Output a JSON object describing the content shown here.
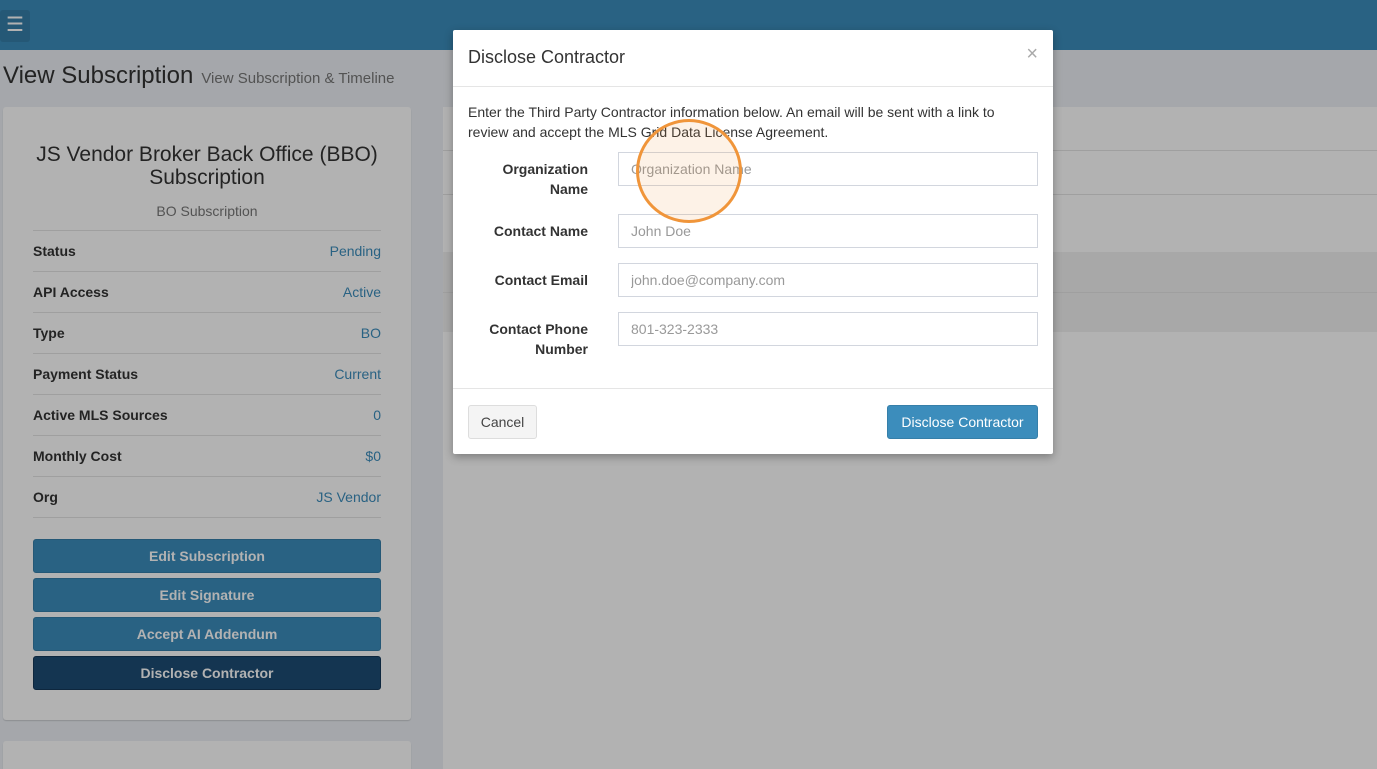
{
  "header": {
    "menu_icon": "hamburger-icon",
    "menu_glyph": "☰"
  },
  "page": {
    "title": "View Subscription",
    "subtitle": "View Subscription & Timeline"
  },
  "subscription": {
    "title": "JS Vendor Broker Back Office (BBO) Subscription",
    "subtitle": "BO Subscription",
    "fields": [
      {
        "label": "Status",
        "value": "Pending"
      },
      {
        "label": "API Access",
        "value": "Active"
      },
      {
        "label": "Type",
        "value": "BO"
      },
      {
        "label": "Payment Status",
        "value": "Current"
      },
      {
        "label": "Active MLS Sources",
        "value": "0"
      },
      {
        "label": "Monthly Cost",
        "value": "$0"
      },
      {
        "label": "Org",
        "value": "JS Vendor"
      }
    ],
    "buttons": {
      "edit_subscription": "Edit Subscription",
      "edit_signature": "Edit Signature",
      "accept_ai_addendum": "Accept AI Addendum",
      "disclose_contractor": "Disclose Contractor"
    }
  },
  "modal": {
    "title": "Disclose Contractor",
    "close_glyph": "×",
    "description": "Enter the Third Party Contractor information below. An email will be sent with a link to review and accept the MLS Grid Data License Agreement.",
    "fields": {
      "org_name": {
        "label": "Organization Name",
        "placeholder": "Organization Name",
        "value": ""
      },
      "contact_name": {
        "label": "Contact Name",
        "placeholder": "John Doe",
        "value": ""
      },
      "contact_email": {
        "label": "Contact Email",
        "placeholder": "john.doe@company.com",
        "value": ""
      },
      "contact_phone": {
        "label": "Contact Phone Number",
        "placeholder": "801-323-2333",
        "value": ""
      }
    },
    "cancel_label": "Cancel",
    "submit_label": "Disclose Contractor"
  },
  "colors": {
    "primary": "#3c8dbc",
    "primary_active": "#1e4d75",
    "click_indicator": "#f0953a"
  }
}
